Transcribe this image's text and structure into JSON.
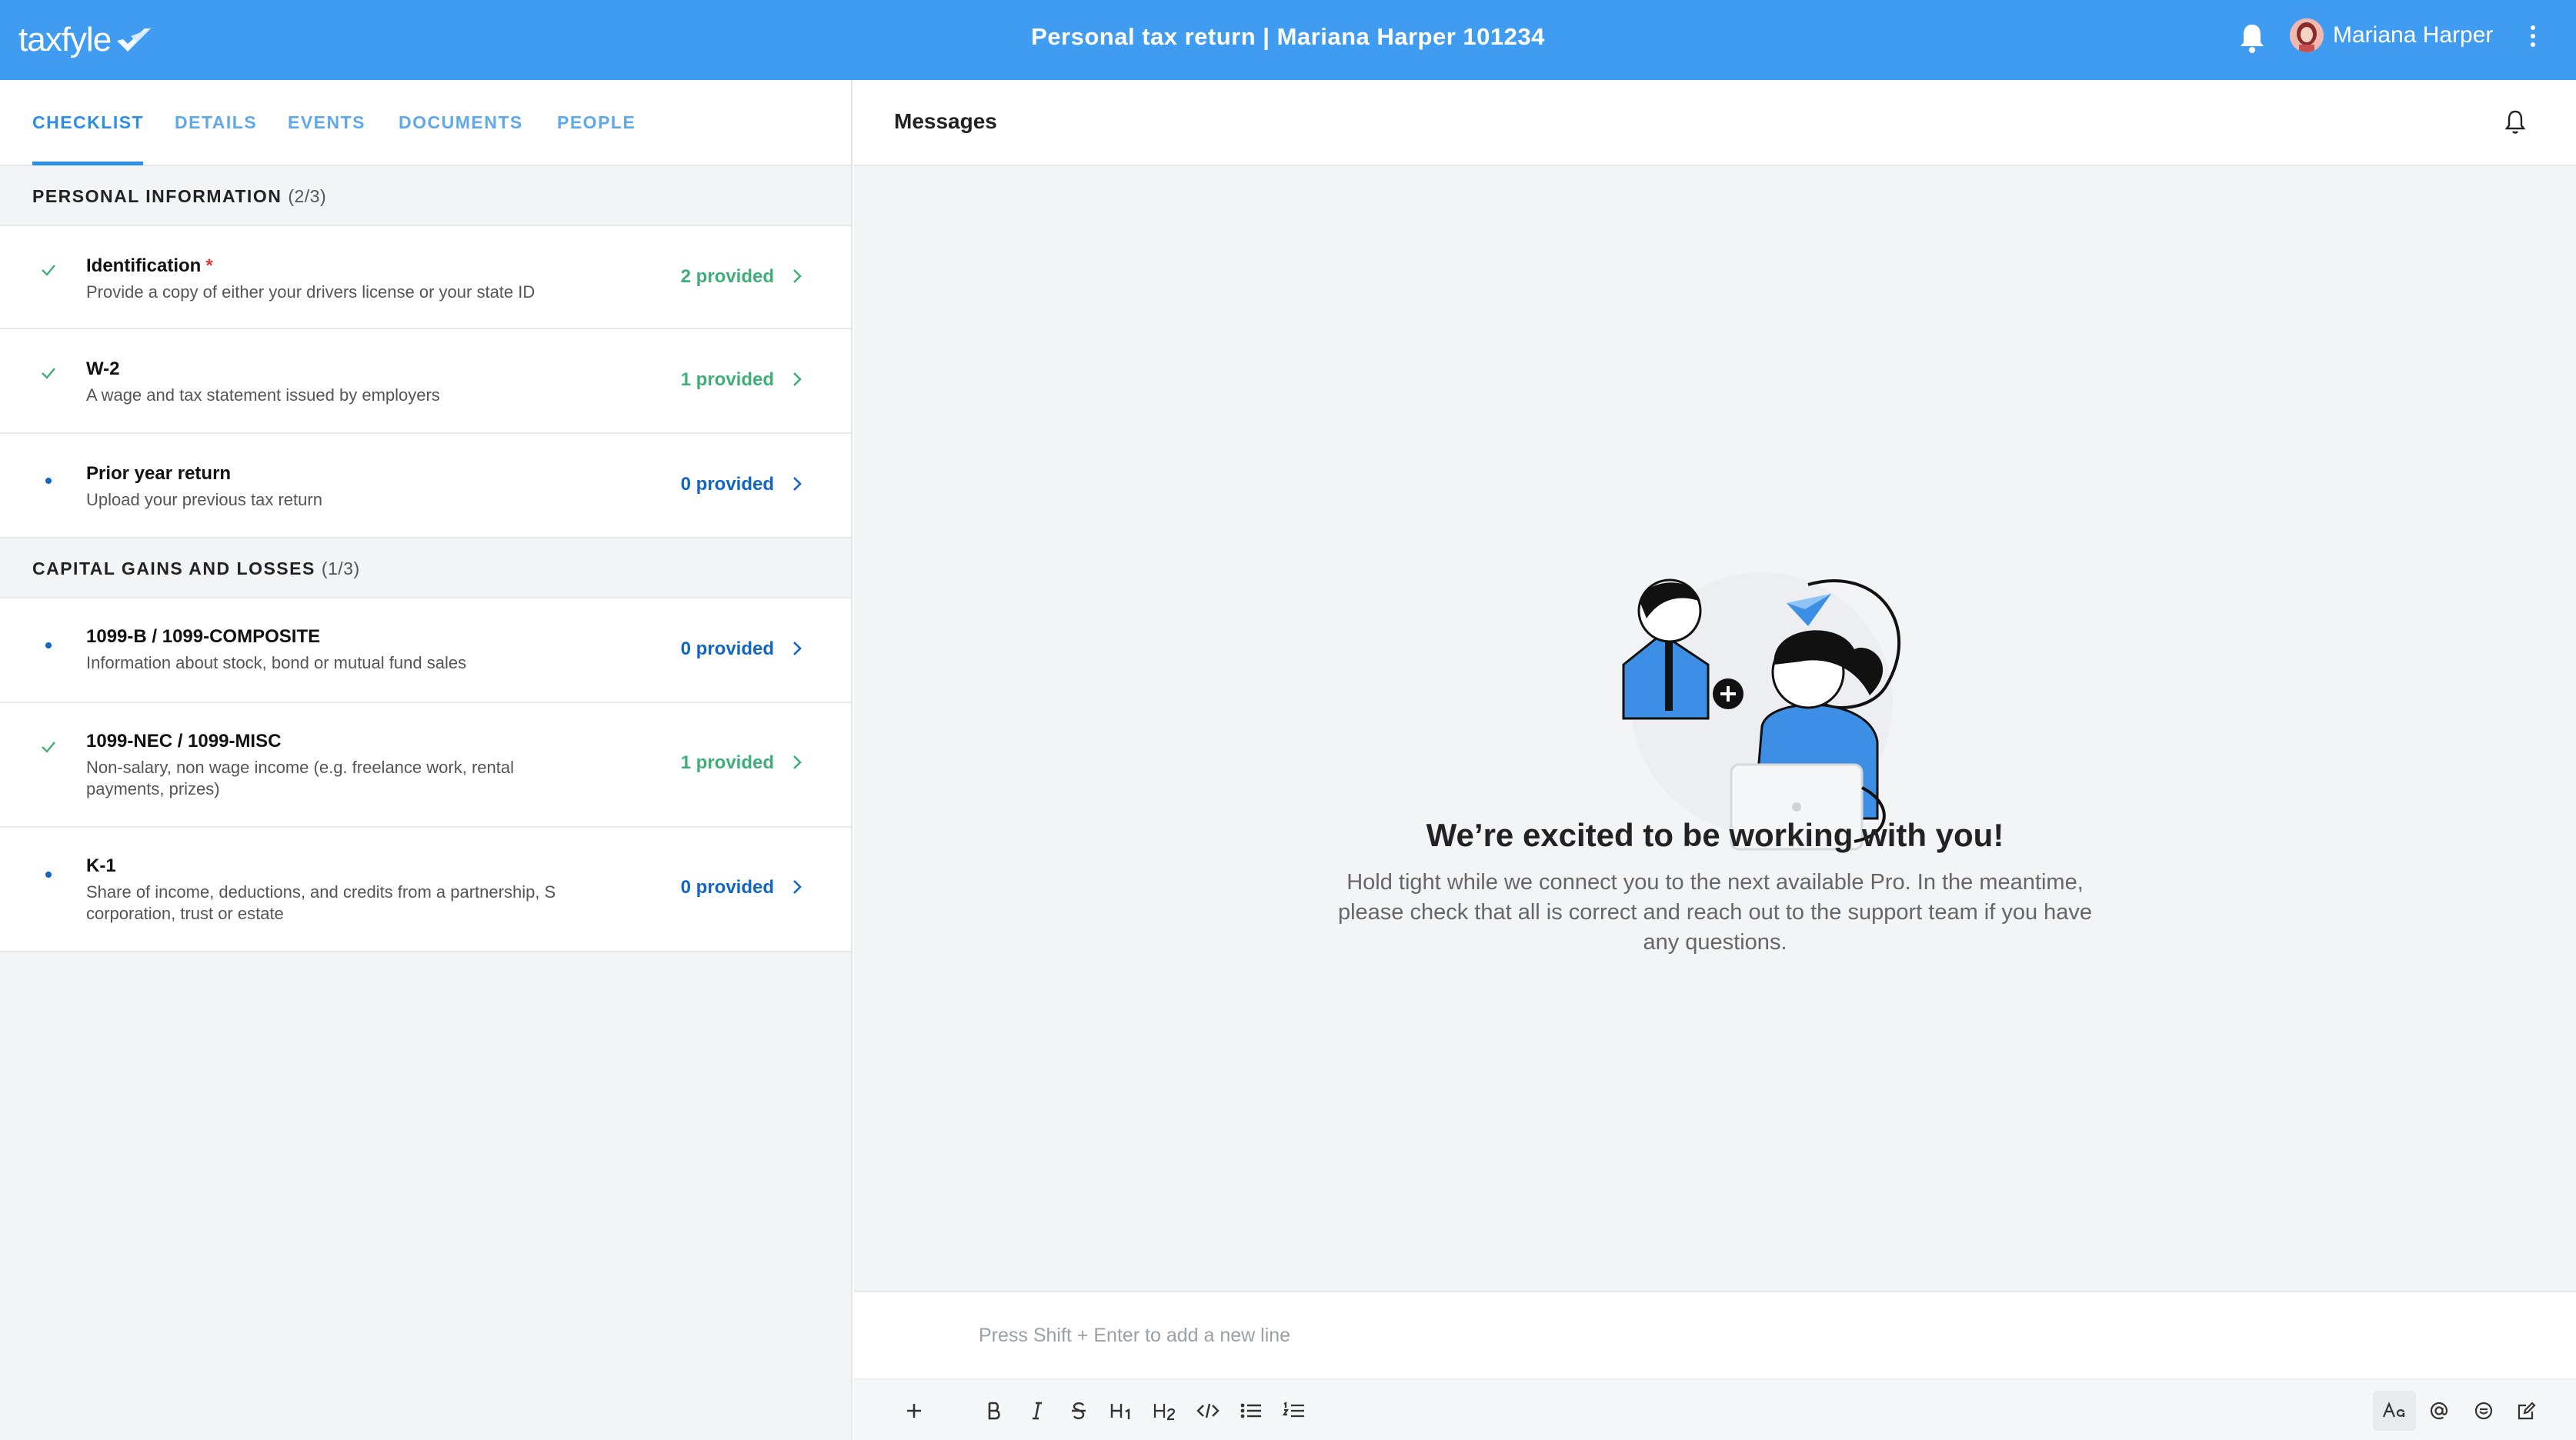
{
  "header": {
    "logo_text": "taxfyle",
    "title": "Personal tax return | Mariana Harper 101234",
    "user_name": "Mariana Harper"
  },
  "tabs": [
    {
      "label": "CHECKLIST",
      "active": true
    },
    {
      "label": "DETAILS"
    },
    {
      "label": "EVENTS"
    },
    {
      "label": "DOCUMENTS"
    },
    {
      "label": "PEOPLE"
    }
  ],
  "sections": [
    {
      "title": "PERSONAL INFORMATION",
      "count": "(2/3)"
    },
    {
      "title": "CAPITAL GAINS AND LOSSES",
      "count": "(1/3)"
    }
  ],
  "items": [
    {
      "title": "Identification",
      "required": "*",
      "desc": "Provide a copy of either your drivers license or your state ID",
      "provided": "2 provided",
      "status": "done"
    },
    {
      "title": "W-2",
      "desc": "A wage and tax statement issued by employers",
      "provided": "1 provided",
      "status": "done"
    },
    {
      "title": "Prior year return",
      "desc": "Upload your previous tax return",
      "provided": "0 provided",
      "status": "pending"
    },
    {
      "title": "1099-B / 1099-COMPOSITE",
      "desc": "Information about stock, bond or mutual fund sales",
      "provided": "0 provided",
      "status": "pending"
    },
    {
      "title": "1099-NEC / 1099-MISC",
      "desc": "Non-salary, non wage income (e.g. freelance work, rental payments, prizes)",
      "provided": "1 provided",
      "status": "done"
    },
    {
      "title": "K-1",
      "desc": "Share of income, deductions, and credits from a partnership, S corporation, trust or estate",
      "provided": "0 provided",
      "status": "pending"
    }
  ],
  "messages": {
    "title": "Messages",
    "welcome_title": "We’re excited to be working with you!",
    "welcome_text": "Hold tight while we connect you to the next available Pro. In the meantime, please check that all is correct and reach out to the support team if you have any questions.",
    "composer_placeholder": "Press Shift + Enter to add a new line"
  },
  "colors": {
    "brand": "#409cf0",
    "tab_active": "#2d8ee8",
    "provided_done": "#3fae77",
    "provided_pending": "#1166c4"
  },
  "icons": [
    "bell-icon",
    "kebab-menu-icon",
    "check-icon",
    "dot-icon",
    "chevron-right-icon",
    "plus-icon",
    "bold-icon",
    "italic-icon",
    "strikethrough-icon",
    "heading1-icon",
    "heading2-icon",
    "code-icon",
    "bullet-list-icon",
    "numbered-list-icon",
    "text-format-icon",
    "mention-icon",
    "emoji-icon",
    "edit-icon"
  ]
}
